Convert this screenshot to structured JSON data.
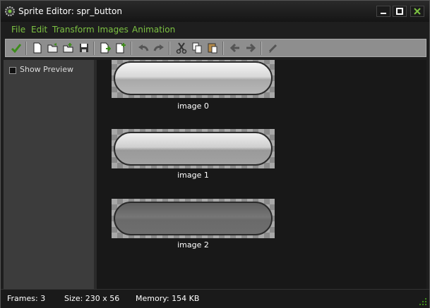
{
  "window": {
    "title": "Sprite Editor: spr_button"
  },
  "menu": [
    {
      "label": "File"
    },
    {
      "label": "Edit"
    },
    {
      "label": "Transform"
    },
    {
      "label": "Images"
    },
    {
      "label": "Animation"
    }
  ],
  "toolbar": {
    "buttons": [
      "confirm-icon",
      "new-icon",
      "open-icon",
      "add-from-file-icon",
      "save-icon",
      "insert-image-icon",
      "add-image-icon",
      "undo-icon",
      "redo-icon",
      "cut-icon",
      "copy-icon",
      "paste-icon",
      "shift-left-icon",
      "shift-right-icon",
      "edit-icon"
    ]
  },
  "sidebar": {
    "show_preview_label": "Show Preview",
    "show_preview_checked": false
  },
  "frames": [
    {
      "label": "image 0",
      "fill": "#b8b8b8"
    },
    {
      "label": "image 1",
      "fill": "#a2a2a2"
    },
    {
      "label": "image 2",
      "fill": "#6e6e6e"
    }
  ],
  "status": {
    "frames": "Frames: 3",
    "size": "Size: 230 x 56",
    "memory": "Memory: 154 KB"
  },
  "colors": {
    "accent": "#7cc242"
  }
}
